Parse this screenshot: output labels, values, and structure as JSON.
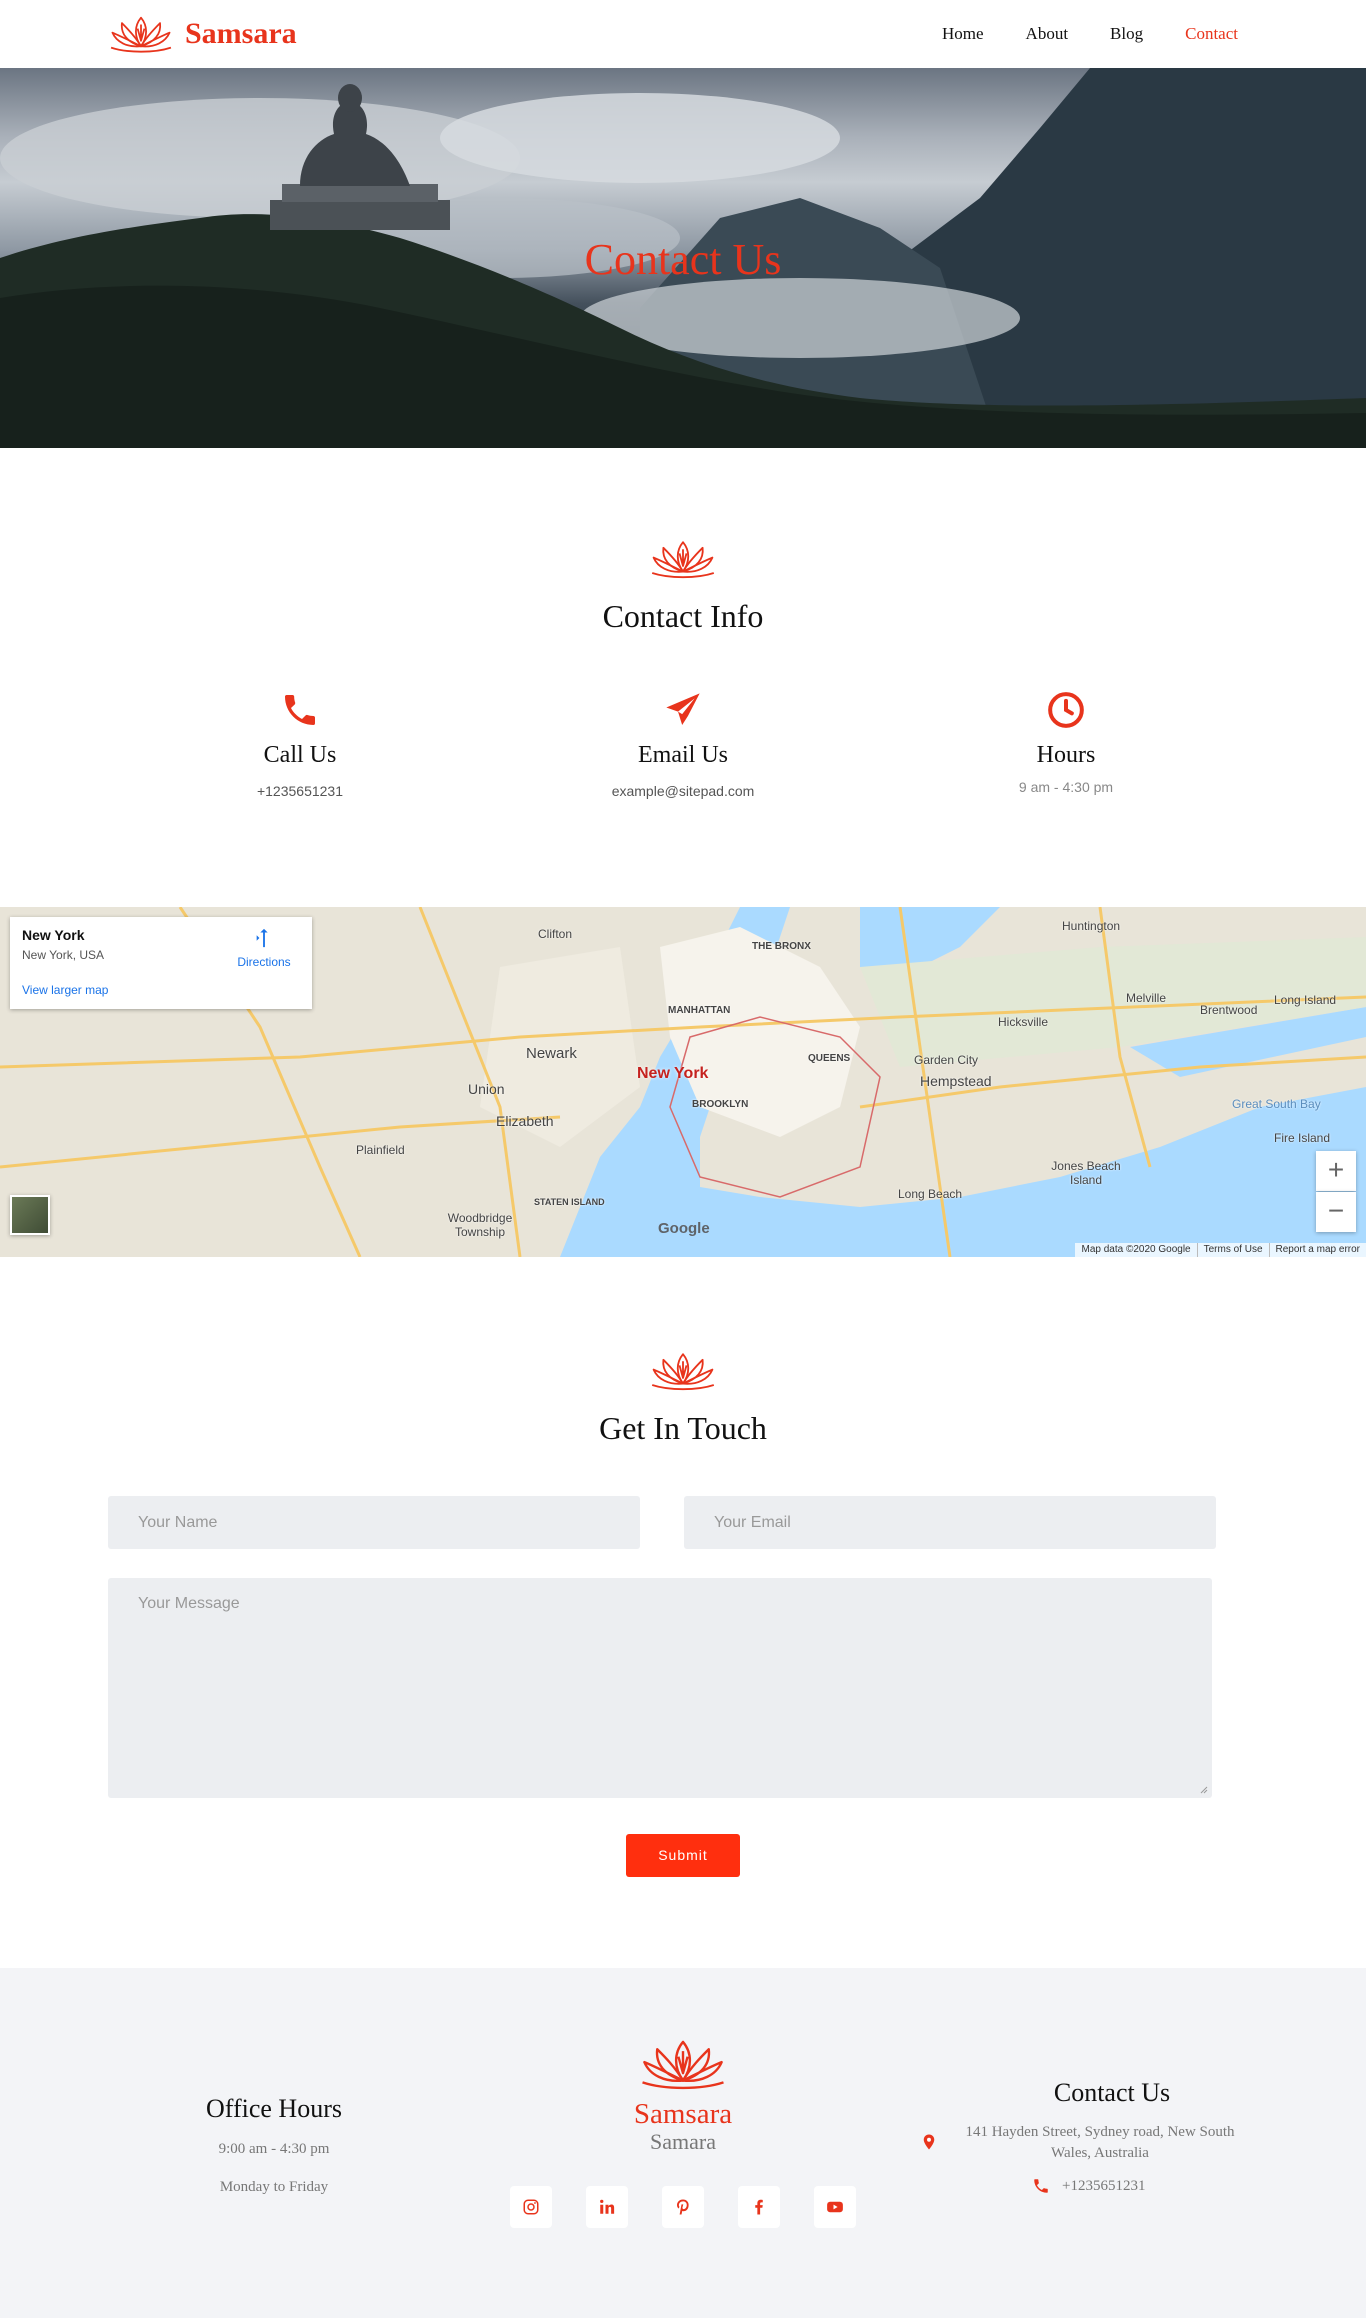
{
  "header": {
    "logo_text": "Samsara",
    "nav": [
      {
        "label": "Home",
        "active": false
      },
      {
        "label": "About",
        "active": false
      },
      {
        "label": "Blog",
        "active": false
      },
      {
        "label": "Contact",
        "active": true
      }
    ]
  },
  "hero": {
    "title": "Contact Us"
  },
  "contact_info": {
    "title": "Contact Info",
    "items": [
      {
        "title": "Call Us",
        "value": "+1235651231",
        "icon": "phone-icon"
      },
      {
        "title": "Email Us",
        "value": "example@sitepad.com",
        "icon": "paper-plane-icon"
      },
      {
        "title": "Hours",
        "value": "9 am - 4:30 pm",
        "icon": "clock-icon"
      }
    ]
  },
  "map": {
    "place": "New York",
    "address": "New York, USA",
    "directions": "Directions",
    "view_larger": "View larger map",
    "city_label": "New York",
    "zoom_in": "+",
    "zoom_out": "−",
    "google": "Google",
    "attribution": [
      "Map data ©2020 Google",
      "Terms of Use",
      "Report a map error"
    ],
    "labels": [
      "Clifton",
      "Newark",
      "Union",
      "Elizabeth",
      "MANHATTAN",
      "THE BRONX",
      "QUEENS",
      "BROOKLYN",
      "Hempstead",
      "Jones Beach Island",
      "Long Island",
      "Huntington",
      "Plainfield",
      "Woodbridge Township",
      "STATEN ISLAND",
      "Garden City",
      "Long Beach",
      "Great South Bay",
      "Fire Island",
      "Brentwood",
      "Melville",
      "Hicksville"
    ]
  },
  "get_in_touch": {
    "title": "Get In Touch",
    "name_placeholder": "Your Name",
    "email_placeholder": "Your Email",
    "message_placeholder": "Your Message",
    "submit_label": "Submit"
  },
  "footer": {
    "hours_title": "Office Hours",
    "hours_time": "9:00 am - 4:30 pm",
    "hours_days": "Monday to Friday",
    "brand_name": "Samsara",
    "brand_sub": "Samara",
    "socials": [
      "instagram-icon",
      "linkedin-icon",
      "pinterest-icon",
      "facebook-icon",
      "youtube-icon"
    ],
    "contact_title": "Contact Us",
    "address": "141 Hayden Street, Sydney road, New South Wales, Australia",
    "phone": "+1235651231"
  },
  "colors": {
    "accent": "#e8341c",
    "button": "#ff2f0e",
    "footer_bg": "#f3f4f7",
    "field_bg": "#eceef1"
  }
}
